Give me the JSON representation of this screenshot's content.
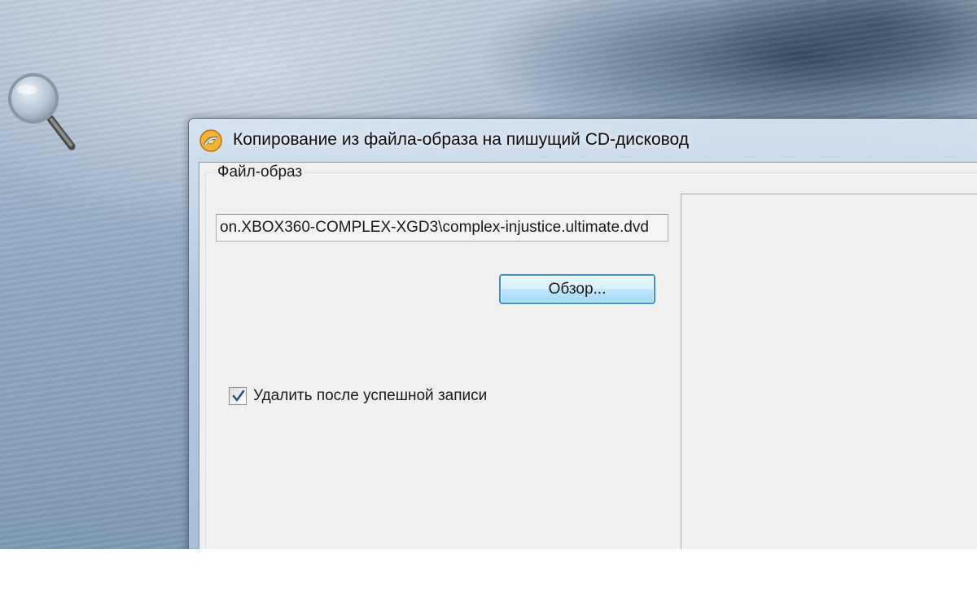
{
  "desktop": {
    "magnifier_icon": "magnifier-icon"
  },
  "dialog": {
    "icon": "burn-disc-app-icon",
    "title": "Копирование из файла-образа на пишущий CD-дисковод",
    "file_group": {
      "label": "Файл-образ",
      "path_value": "on.XBOX360-COMPLEX-XGD3\\complex-injustice.ultimate.dvd",
      "browse_label": "Обзор...",
      "delete_after_write": {
        "label": "Удалить после успешной записи",
        "checked": true
      }
    }
  },
  "colors": {
    "button_border": "#3c8fd6",
    "checkmark": "#2b4f8a",
    "window_frame": "#b9cde4"
  }
}
